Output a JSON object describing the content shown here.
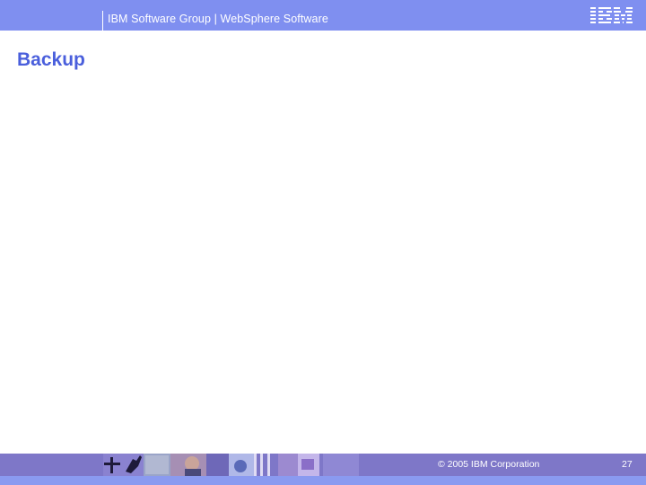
{
  "header": {
    "title": "IBM Software Group | WebSphere Software",
    "logo_text": "IBM",
    "logo_icon": "ibm-logo-icon",
    "background_color": "#7f8ff0"
  },
  "slide": {
    "title": "Backup",
    "title_color": "#4a5fdc"
  },
  "footer": {
    "copyright": "© 2005 IBM Corporation",
    "page_number": "27",
    "background_color": "#7e77c8",
    "decorative_image": "photo-collage-icon"
  }
}
